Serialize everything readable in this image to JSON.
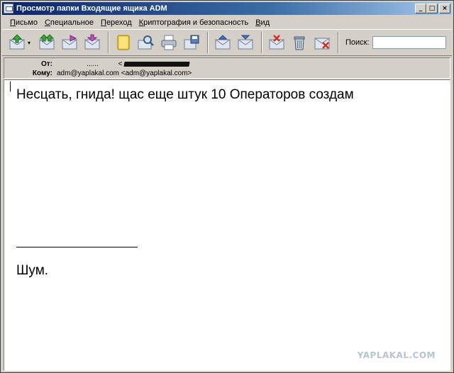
{
  "window": {
    "title": "Просмотр папки Входящие ящика ADM",
    "min_label": "_",
    "max_label": "□",
    "close_label": "×"
  },
  "menu": {
    "items": [
      "Письмо",
      "Специальное",
      "Переход",
      "Криптография и безопасность",
      "Вид"
    ]
  },
  "toolbar": {
    "search_label": "Поиск:",
    "search_value": "",
    "dropdown_arrow": "▾",
    "icons": [
      "reply-icon",
      "reply-all-icon",
      "forward-icon",
      "send-icon",
      "address-book-icon",
      "find-icon",
      "print-icon",
      "save-icon",
      "previous-icon",
      "next-icon",
      "mark-icon",
      "delete-icon",
      "junk-icon"
    ]
  },
  "header": {
    "from_label": "От:",
    "from_name": "......",
    "from_bracket": "<",
    "to_label": "Кому:",
    "to_value": "adm@yaplakal.com <adm@yaplakal.com>"
  },
  "message": {
    "line1": "Несцать, гнида! щас еще штук 10 Операторов создам",
    "signature": "Шум.",
    "watermark": "YAPLAKAL.COM"
  },
  "colors": {
    "titlebar_start": "#0a246a",
    "titlebar_end": "#a6caf0",
    "chrome": "#d4d0c8"
  }
}
